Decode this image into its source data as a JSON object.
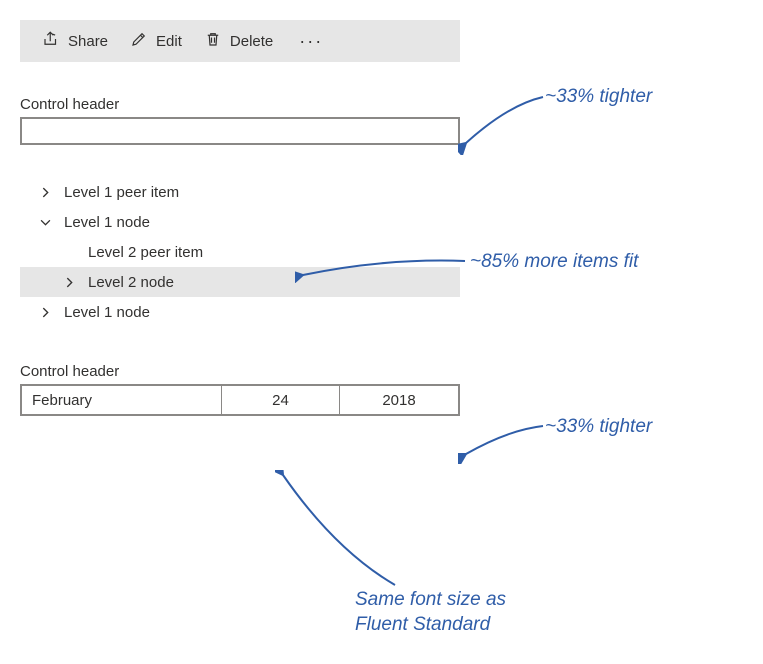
{
  "toolbar": {
    "share_label": "Share",
    "edit_label": "Edit",
    "delete_label": "Delete",
    "overflow_glyph": "···"
  },
  "input_section": {
    "header": "Control header"
  },
  "tree": {
    "items": [
      {
        "label": "Level 1 peer item",
        "chevron": "right"
      },
      {
        "label": "Level 1 node",
        "chevron": "down"
      },
      {
        "label": "Level 2 peer item",
        "chevron": "none",
        "indent": 1
      },
      {
        "label": "Level 2 node",
        "chevron": "right",
        "indent": 1,
        "selected": true
      },
      {
        "label": "Level 1 node",
        "chevron": "right"
      }
    ]
  },
  "date_section": {
    "header": "Control header",
    "month": "February",
    "day": "24",
    "year": "2018"
  },
  "annotations": {
    "a1": "~33% tighter",
    "a2": "~85% more items fit",
    "a3": "~33% tighter",
    "a4_line1": "Same font size as",
    "a4_line2": "Fluent Standard"
  }
}
